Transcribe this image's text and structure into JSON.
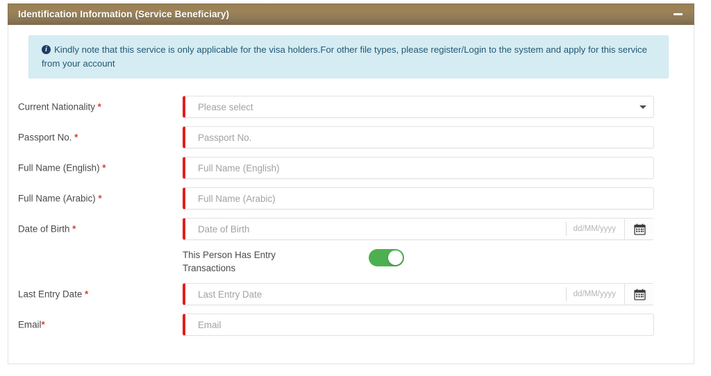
{
  "panel": {
    "title": "Identification Information (Service Beneficiary)",
    "minimize_label": "−"
  },
  "alert": {
    "icon": "info-icon",
    "text": "Kindly note that this service is only applicable for the visa holders.For other file types, please register/Login to the system and apply for this service from your account"
  },
  "fields": {
    "nationality": {
      "label": "Current Nationality *",
      "label_text": "Current Nationality",
      "placeholder": "Please select",
      "value": ""
    },
    "passport": {
      "label": "Passport No. *",
      "placeholder": "Passport No.",
      "value": ""
    },
    "full_name_en": {
      "label": "Full Name (English) *",
      "placeholder": "Full Name (English)",
      "value": ""
    },
    "full_name_ar": {
      "label": "Full Name (Arabic) *",
      "placeholder": "Full Name (Arabic)",
      "value": ""
    },
    "date_of_birth": {
      "label": "Date of Birth *",
      "placeholder": "Date of Birth",
      "format_hint": "dd/MM/yyyy",
      "value": ""
    },
    "entry_transactions": {
      "label": "This Person Has Entry Transactions",
      "state": "on"
    },
    "last_entry_date": {
      "label": "Last Entry Date *",
      "placeholder": "Last Entry Date",
      "format_hint": "dd/MM/yyyy",
      "value": ""
    },
    "email": {
      "label": "Email*",
      "placeholder": "Email",
      "value": ""
    }
  },
  "colors": {
    "header_gradient_top": "#9a8055",
    "header_gradient_bottom": "#7d6b4e",
    "alert_bg": "#d6ecf3",
    "alert_text": "#215873",
    "required_bar": "#e02020",
    "required_star": "#d9433f",
    "toggle_on": "#4cb050"
  }
}
